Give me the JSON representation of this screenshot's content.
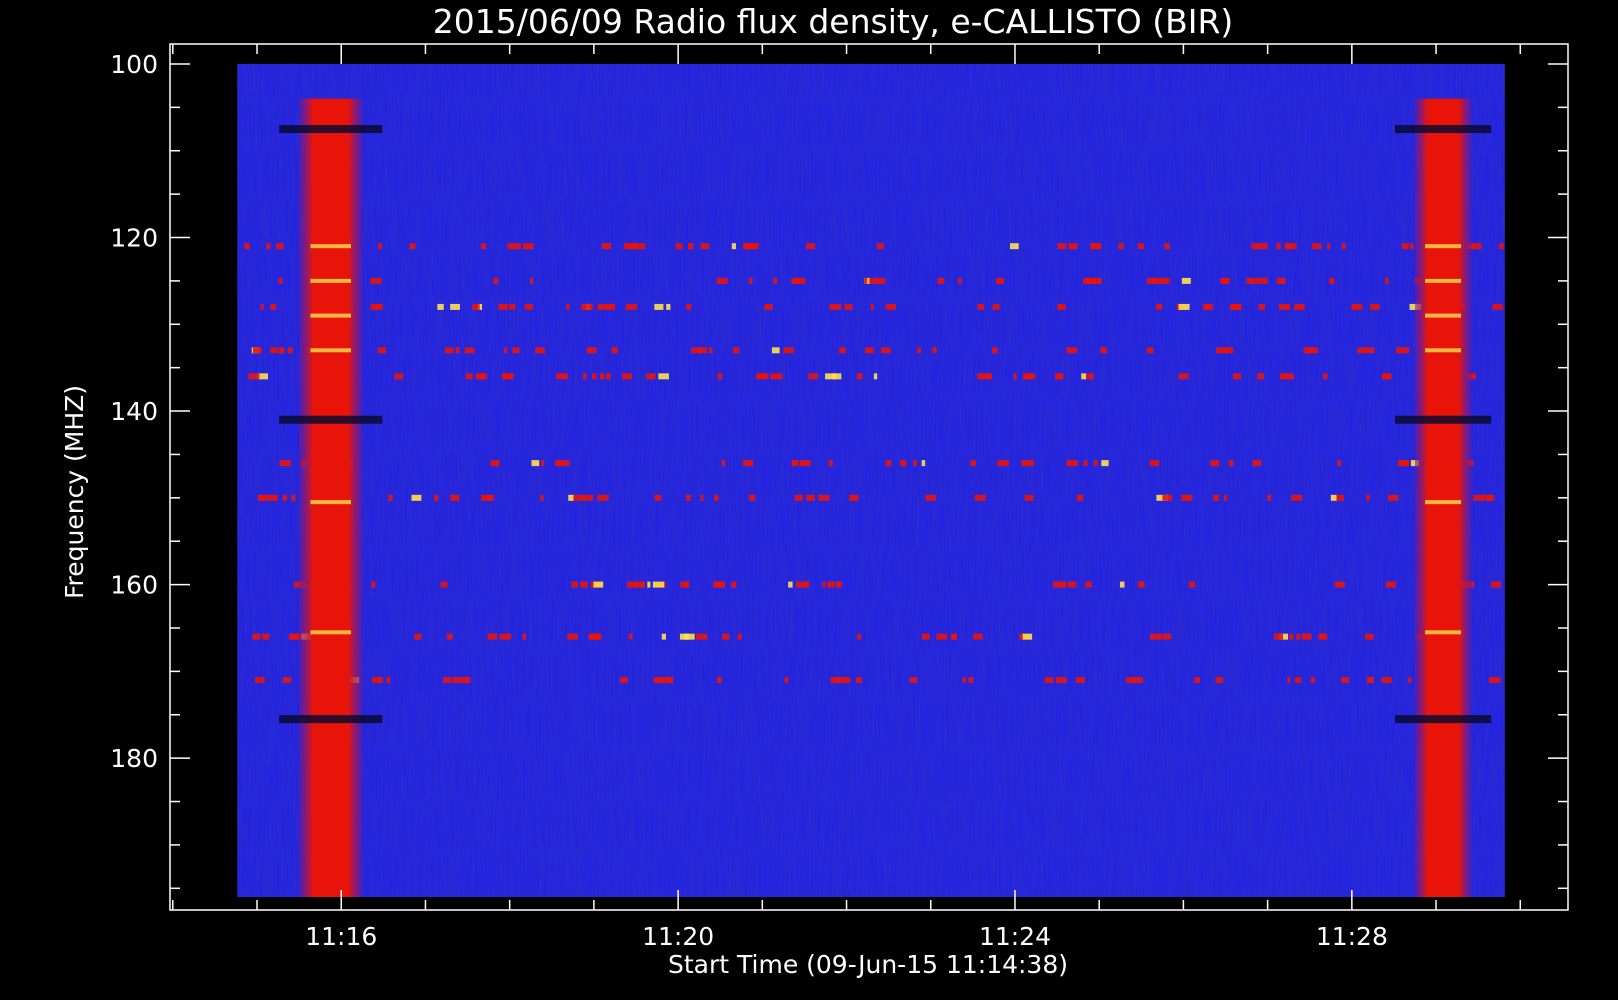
{
  "chart_data": {
    "type": "heatmap",
    "title": "2015/06/09  Radio flux density, e-CALLISTO (BIR)",
    "xlabel": "Start Time (09-Jun-15 11:14:38)",
    "ylabel": "Frequency (MHZ)",
    "x_unit": "time (HH:MM)",
    "xlim": [
      "11:13:58",
      "11:30:34"
    ],
    "ylim": [
      197.5,
      97.7
    ],
    "y_inverted": true,
    "data_extent": {
      "t_start": "11:14:46",
      "t_end": "11:29:49",
      "f_min": 100,
      "f_max": 196
    },
    "x_ticks": [
      "11:16",
      "11:20",
      "11:24",
      "11:28"
    ],
    "x_minor_every_min": 1,
    "y_ticks": [
      100,
      120,
      140,
      160,
      180
    ],
    "y_minor_every_mhz": 5,
    "colormap": "blue-red-yellow-white (background #2020e8)",
    "colors": {
      "background": "#000000",
      "field": "#2121e6",
      "burst": "#e8140a",
      "hot": "#ffe14a",
      "axis": "#ffffff"
    },
    "features": {
      "broadband_bursts": [
        {
          "t_start": "11:15:30",
          "t_end": "11:16:15",
          "f_min": 104,
          "f_max": 196
        },
        {
          "t_start": "11:28:45",
          "t_end": "11:29:25",
          "f_min": 104,
          "f_max": 196
        }
      ],
      "interference_lines_mhz": [
        121,
        125,
        128,
        133,
        136,
        146,
        150,
        160,
        166,
        171
      ]
    }
  }
}
